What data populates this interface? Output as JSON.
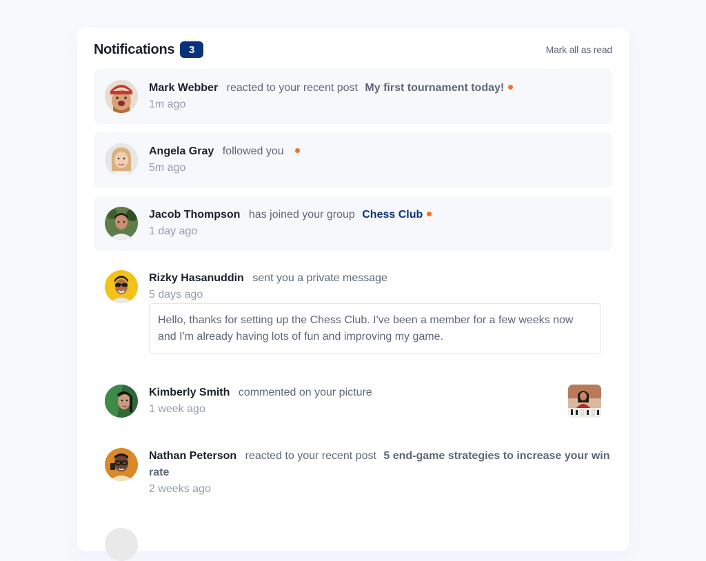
{
  "header": {
    "title": "Notifications",
    "unread_count": "3",
    "mark_all_label": "Mark all as read"
  },
  "notifications": [
    {
      "name": "Mark Webber",
      "action": "reacted to your recent post",
      "post": "My first tournament today!",
      "time": "1m ago",
      "unread": true
    },
    {
      "name": "Angela Gray",
      "action": "followed you",
      "time": "5m ago",
      "unread": true
    },
    {
      "name": "Jacob Thompson",
      "action": "has joined your group",
      "group": "Chess Club",
      "time": "1 day ago",
      "unread": true
    },
    {
      "name": "Rizky Hasanuddin",
      "action": "sent you a private message",
      "time": "5 days ago",
      "message": "Hello, thanks for setting up the Chess Club. I've been a member for a few weeks now and I'm already having lots of fun and improving my game.",
      "unread": false
    },
    {
      "name": "Kimberly Smith",
      "action": "commented on your picture",
      "time": "1 week ago",
      "unread": false
    },
    {
      "name": "Nathan Peterson",
      "action": "reacted to your recent post",
      "post": "5 end-game strategies to increase your win rate",
      "time": "2 weeks ago",
      "unread": false
    }
  ],
  "colors": {
    "badge": "#0a327b",
    "unread_bg": "#f6f8fb",
    "dot": "#f0702a",
    "page_bg": "#f7f9fc"
  }
}
